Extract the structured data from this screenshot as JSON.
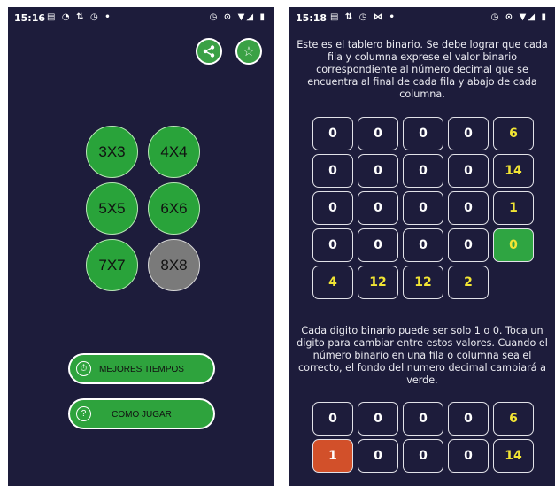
{
  "colors": {
    "background": "#1d1c3b",
    "button_green": "#29a33a",
    "button_grey": "#7a7a7a",
    "decimal_yellow": "#f2e534",
    "correct_green": "#2fa542",
    "active_red": "#d2502a"
  },
  "left_screen": {
    "status": {
      "time": "15:16",
      "icons": "▤ ◔ ⇅ ◷ •",
      "right_icons": "◷ ⊙ ▼◢ ▮"
    },
    "top_buttons": [
      {
        "icon": "share-icon",
        "glyph": "<"
      },
      {
        "icon": "star-icon",
        "glyph": "☆"
      }
    ],
    "sizes": [
      "3X3",
      "4X4",
      "5X5",
      "6X6",
      "7X7",
      "8X8"
    ],
    "buttons": {
      "best_times": "MEJORES TIEMPOS",
      "best_times_icon": "⏱",
      "how_to_play": "COMO JUGAR",
      "how_to_play_icon": "?"
    }
  },
  "right_screen": {
    "status": {
      "time": "15:18",
      "icons": "▤ ⇅ ◷ ⋈ •",
      "right_icons": "◷ ⊙ ▼◢ ▮"
    },
    "intro_text": "Este es el tablero binario. Se debe lograr que cada fila y columna exprese el valor binario correspondiente al número decimal que se encuentra al final de cada fila y abajo de cada columna.",
    "board1": {
      "rows": [
        {
          "bits": [
            "0",
            "0",
            "0",
            "0"
          ],
          "decimal": "6",
          "decimal_state": "normal"
        },
        {
          "bits": [
            "0",
            "0",
            "0",
            "0"
          ],
          "decimal": "14",
          "decimal_state": "normal"
        },
        {
          "bits": [
            "0",
            "0",
            "0",
            "0"
          ],
          "decimal": "1",
          "decimal_state": "normal"
        },
        {
          "bits": [
            "0",
            "0",
            "0",
            "0"
          ],
          "decimal": "0",
          "decimal_state": "correct"
        }
      ],
      "col_decimals": [
        "4",
        "12",
        "12",
        "2"
      ]
    },
    "explain_text": "Cada digito binario puede ser solo 1 o 0. Toca un digito para cambiar entre estos valores. Cuando el número binario en una fila o columna sea el correcto, el fondo del numero decimal cambiará a verde.",
    "board2": {
      "rows": [
        {
          "bits": [
            "0",
            "0",
            "0",
            "0"
          ],
          "decimal": "6",
          "active_bits": []
        },
        {
          "bits": [
            "1",
            "0",
            "0",
            "0"
          ],
          "decimal": "14",
          "active_bits": [
            0
          ]
        }
      ]
    }
  }
}
